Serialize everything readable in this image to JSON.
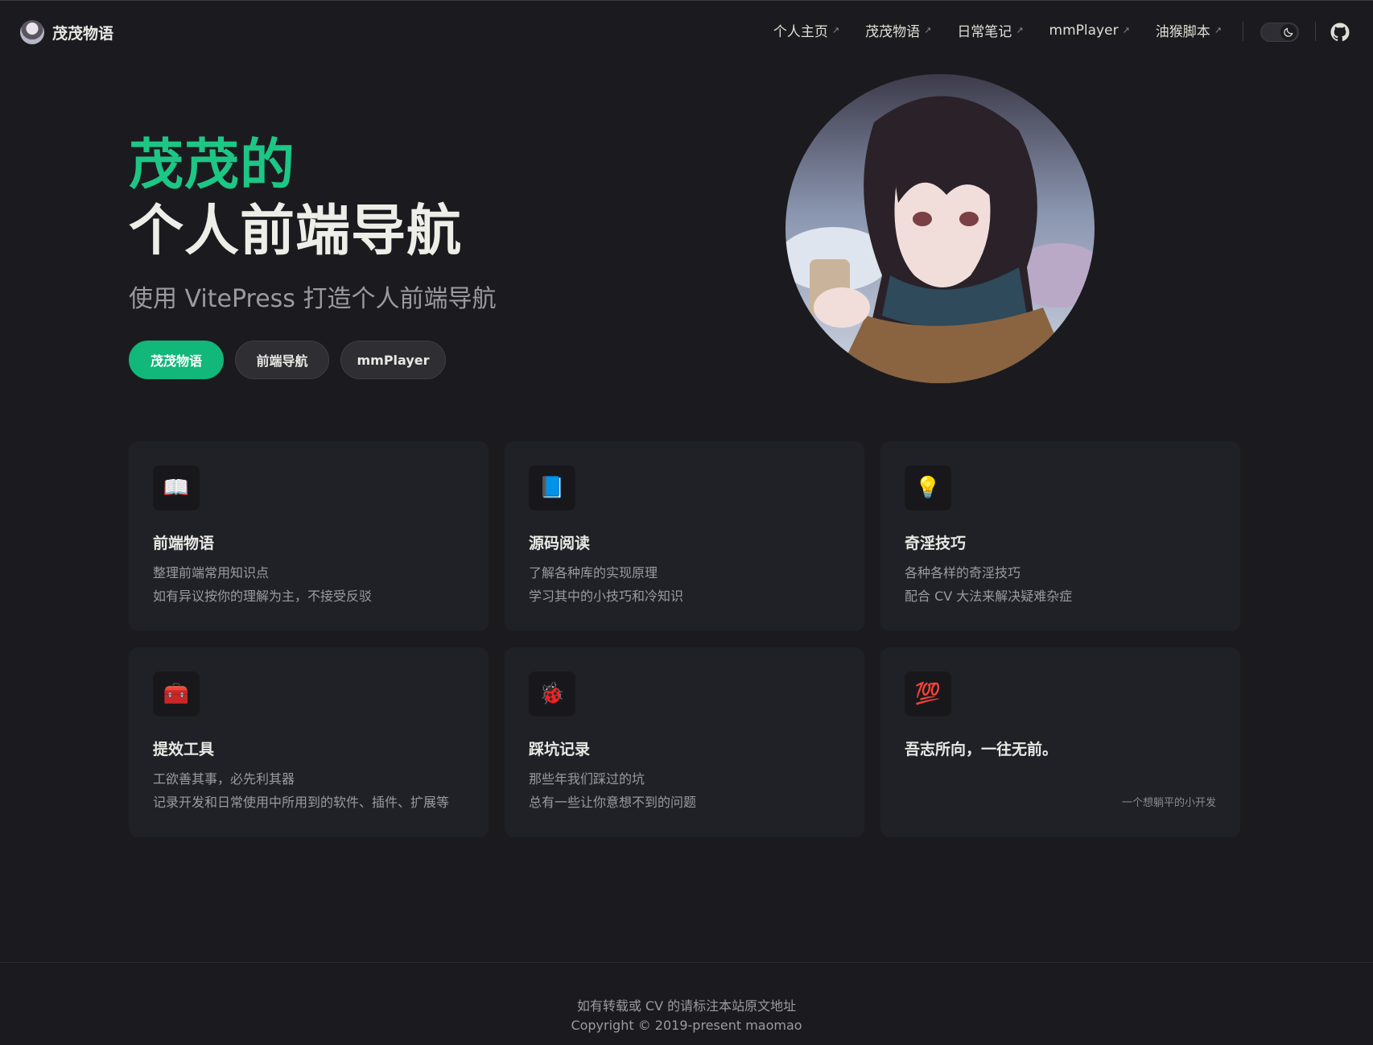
{
  "site": {
    "title": "茂茂物语"
  },
  "nav": {
    "links": [
      {
        "label": "个人主页"
      },
      {
        "label": "茂茂物语"
      },
      {
        "label": "日常笔记"
      },
      {
        "label": "mmPlayer"
      },
      {
        "label": "油猴脚本"
      }
    ],
    "external_glyph": "↗",
    "appearance_icon": "moon-icon",
    "social_icon": "github-icon"
  },
  "hero": {
    "name": "茂茂的",
    "text": "个人前端导航",
    "tagline": "使用 VitePress 打造个人前端导航",
    "actions": [
      {
        "label": "茂茂物语",
        "theme": "brand"
      },
      {
        "label": "前端导航",
        "theme": "alt"
      },
      {
        "label": "mmPlayer",
        "theme": "alt"
      }
    ]
  },
  "features": [
    {
      "icon": "📖",
      "icon_name": "open-book-icon",
      "title": "前端物语",
      "lines": [
        "整理前端常用知识点",
        "如有异议按你的理解为主，不接受反驳"
      ]
    },
    {
      "icon": "📘",
      "icon_name": "blue-book-icon",
      "title": "源码阅读",
      "lines": [
        "了解各种库的实现原理",
        "学习其中的小技巧和冷知识"
      ]
    },
    {
      "icon": "💡",
      "icon_name": "light-bulb-icon",
      "title": "奇淫技巧",
      "lines": [
        "各种各样的奇淫技巧",
        "配合 CV 大法来解决疑难杂症"
      ]
    },
    {
      "icon": "🧰",
      "icon_name": "toolbox-icon",
      "title": "提效工具",
      "lines": [
        "工欲善其事，必先利其器",
        "记录开发和日常使用中所用到的软件、插件、扩展等"
      ]
    },
    {
      "icon": "🐞",
      "icon_name": "bug-icon",
      "title": "踩坑记录",
      "lines": [
        "那些年我们踩过的坑",
        "总有一些让你意想不到的问题"
      ]
    },
    {
      "icon": "💯",
      "icon_name": "hundred-points-icon",
      "title": "吾志所向，一往无前。",
      "lines": [],
      "tail": "一个想躺平的小开发"
    }
  ],
  "footer": {
    "message": "如有转载或 CV 的请标注本站原文地址",
    "copyright": "Copyright © 2019-present maomao"
  },
  "colors": {
    "background": "#1b1b1f",
    "brand": "#12b77a",
    "card": "#202127"
  }
}
